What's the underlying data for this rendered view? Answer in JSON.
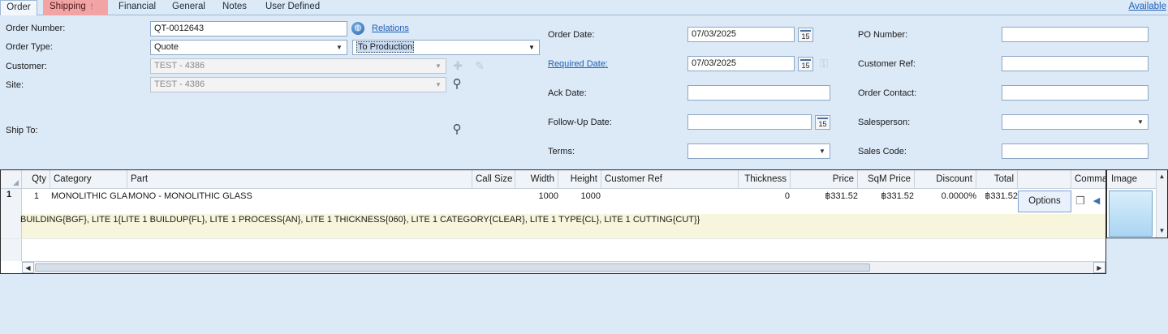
{
  "tabs": {
    "order": "Order",
    "shipping": "Shipping",
    "shipping_warning": "!",
    "financial": "Financial",
    "general": "General",
    "notes": "Notes",
    "user_defined": "User Defined",
    "available_link": "Available"
  },
  "form": {
    "order_number_label": "Order Number:",
    "order_number_value": "QT-0012643",
    "relations_link": "Relations",
    "order_type_label": "Order Type:",
    "order_type_value": "Quote",
    "production_value": "To Production",
    "customer_label": "Customer:",
    "customer_value": "TEST - 4386",
    "site_label": "Site:",
    "site_value": "TEST - 4386",
    "ship_to_label": "Ship To:",
    "order_date_label": "Order Date:",
    "order_date_value": "07/03/2025",
    "required_date_label": "Required Date:",
    "required_date_value": "07/03/2025",
    "ack_date_label": "Ack Date:",
    "ack_date_value": "",
    "followup_date_label": "Follow-Up Date:",
    "followup_date_value": "",
    "terms_label": "Terms:",
    "terms_value": "",
    "po_number_label": "PO Number:",
    "po_number_value": "",
    "customer_ref_label": "Customer Ref:",
    "customer_ref_value": "",
    "order_contact_label": "Order Contact:",
    "order_contact_value": "",
    "salesperson_label": "Salesperson:",
    "salesperson_value": "",
    "sales_code_label": "Sales Code:",
    "sales_code_value": "",
    "calendar_day": "15"
  },
  "grid": {
    "columns": [
      "Qty",
      "Category",
      "Part",
      "Call Size",
      "Width",
      "Height",
      "Customer Ref",
      "Thickness",
      "Price",
      "SqM Price",
      "Discount",
      "Total",
      "Comman"
    ],
    "row": {
      "row_number": "1",
      "qty": "1",
      "category": "MONOLITHIC GLASS",
      "part": "MONO - MONOLITHIC GLASS",
      "call_size": "",
      "width": "1000",
      "height": "1000",
      "customer_ref": "",
      "thickness": "0",
      "price": "฿331.52",
      "sqm_price": "฿331.52",
      "discount": "0.0000%",
      "total": "฿331.52"
    },
    "detail_text": "BUILDING{BGF}, LITE 1{LITE 1 BUILDUP{FL}, LITE 1 PROCESS{AN}, LITE 1 THICKNESS{060}, LITE 1 CATEGORY{CLEAR}, LITE 1 TYPE{CL}, LITE 1 CUTTING{CUT}}",
    "options_button": "Options"
  },
  "image_panel": {
    "header": "Image"
  },
  "icons": {
    "dropdown": "▼",
    "scroll_left": "◀",
    "scroll_right": "▶",
    "scroll_up": "▲",
    "scroll_down": "▼",
    "magnifier": "🔍",
    "globe": "🌐",
    "key": "🔑",
    "copy": "📄"
  },
  "colors": {
    "background": "#dce9f7",
    "shipping_tab": "#f2a4a4",
    "link": "#1f5fb5",
    "detail_row": "#f7f5dc"
  }
}
